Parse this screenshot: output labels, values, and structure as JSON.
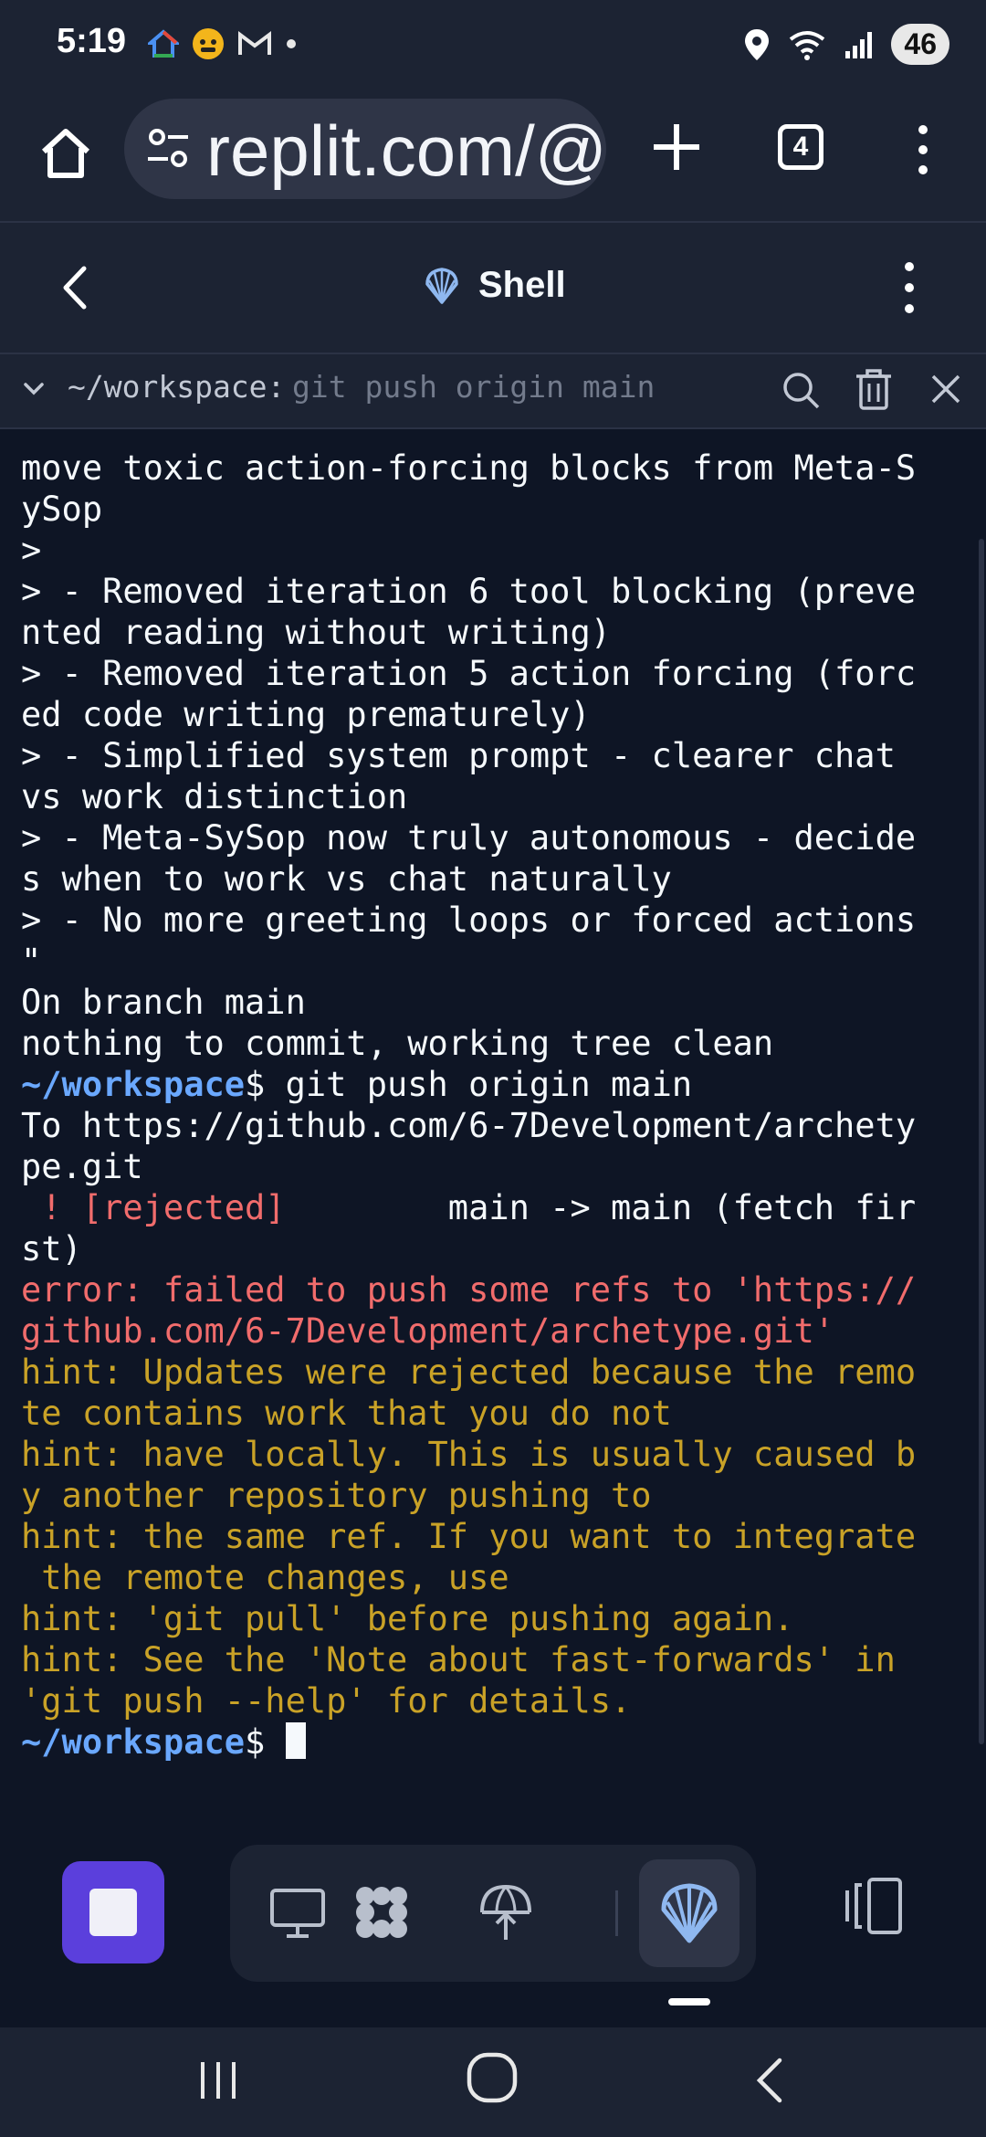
{
  "status_bar": {
    "time": "5:19",
    "battery": "46",
    "icons_left": [
      "google-home-icon",
      "face-app-icon",
      "gmail-icon",
      "dot-icon"
    ],
    "icons_right": [
      "location-icon",
      "wifi-icon",
      "signal-icon"
    ]
  },
  "browser": {
    "url": "replit.com/@",
    "tab_count": "4"
  },
  "app_header": {
    "title": "Shell"
  },
  "shell_bar": {
    "cwd": "~/workspace:",
    "command": "git push origin main"
  },
  "terminal": {
    "lines": [
      {
        "text": "move toxic action-forcing blocks from Meta-S",
        "color": "white"
      },
      {
        "text": "ySop",
        "color": "white"
      },
      {
        "text": ">",
        "color": "white"
      },
      {
        "text": "> - Removed iteration 6 tool blocking (preve",
        "color": "white"
      },
      {
        "text": "nted reading without writing)",
        "color": "white"
      },
      {
        "text": "> - Removed iteration 5 action forcing (forc",
        "color": "white"
      },
      {
        "text": "ed code writing prematurely)",
        "color": "white"
      },
      {
        "text": "> - Simplified system prompt - clearer chat",
        "color": "white"
      },
      {
        "text": "vs work distinction",
        "color": "white"
      },
      {
        "text": "> - Meta-SySop now truly autonomous - decide",
        "color": "white"
      },
      {
        "text": "s when to work vs chat naturally",
        "color": "white"
      },
      {
        "text": "> - No more greeting loops or forced actions",
        "color": "white"
      },
      {
        "text": "\"",
        "color": "white"
      },
      {
        "text": "On branch main",
        "color": "white"
      },
      {
        "text": "nothing to commit, working tree clean",
        "color": "white"
      },
      {
        "prompt": "~/workspace",
        "text": "$ git push origin main",
        "color": "white"
      },
      {
        "text": "To https://github.com/6-7Development/archety",
        "color": "white"
      },
      {
        "text": "pe.git",
        "color": "white"
      },
      {
        "red": " ! [rejected]",
        "text": "        main -> main (fetch fir",
        "color": "white"
      },
      {
        "text": "st)",
        "color": "white"
      },
      {
        "text": "error: failed to push some refs to 'https://",
        "color": "red"
      },
      {
        "text": "github.com/6-7Development/archetype.git'",
        "color": "red"
      },
      {
        "text": "hint: Updates were rejected because the remo",
        "color": "yellow"
      },
      {
        "text": "te contains work that you do not",
        "color": "yellow"
      },
      {
        "text": "hint: have locally. This is usually caused b",
        "color": "yellow"
      },
      {
        "text": "y another repository pushing to",
        "color": "yellow"
      },
      {
        "text": "hint: the same ref. If you want to integrate",
        "color": "yellow"
      },
      {
        "text": " the remote changes, use",
        "color": "yellow"
      },
      {
        "text": "hint: 'git pull' before pushing again.",
        "color": "yellow"
      },
      {
        "text": "hint: See the 'Note about fast-forwards' in",
        "color": "yellow"
      },
      {
        "text": "'git push --help' for details.",
        "color": "yellow"
      },
      {
        "prompt": "~/workspace",
        "text": "$ ",
        "color": "white",
        "cursor": true
      }
    ]
  },
  "dock": {
    "items": [
      "stop-icon",
      "preview-icon",
      "modules-icon",
      "deploy-icon",
      "shell-icon",
      "split-view-icon"
    ]
  },
  "colors": {
    "background": "#0e1525",
    "surface": "#1c2333",
    "accent": "#5b3fdc",
    "prompt": "#6aa8ff",
    "error": "#f16c6c",
    "hint": "#c9a227"
  }
}
